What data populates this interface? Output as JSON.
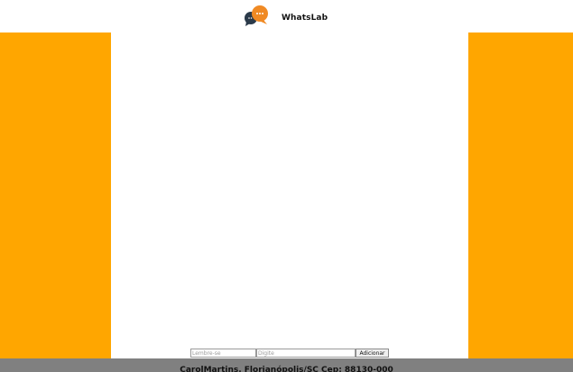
{
  "app": {
    "title": "WhatsLab",
    "logo": "chat-bubbles-logo"
  },
  "colors": {
    "accent": "#ffa600",
    "logo_dark": "#2b3a4a",
    "logo_orange": "#f08a24",
    "footer_bg": "#808080"
  },
  "composer": {
    "remember_placeholder": "Lembre-se",
    "message_placeholder": "Digite",
    "add_label": "Adicionar"
  },
  "footer": {
    "text": "CarolMartins. Florianópolis/SC Cep: 88130-000"
  }
}
